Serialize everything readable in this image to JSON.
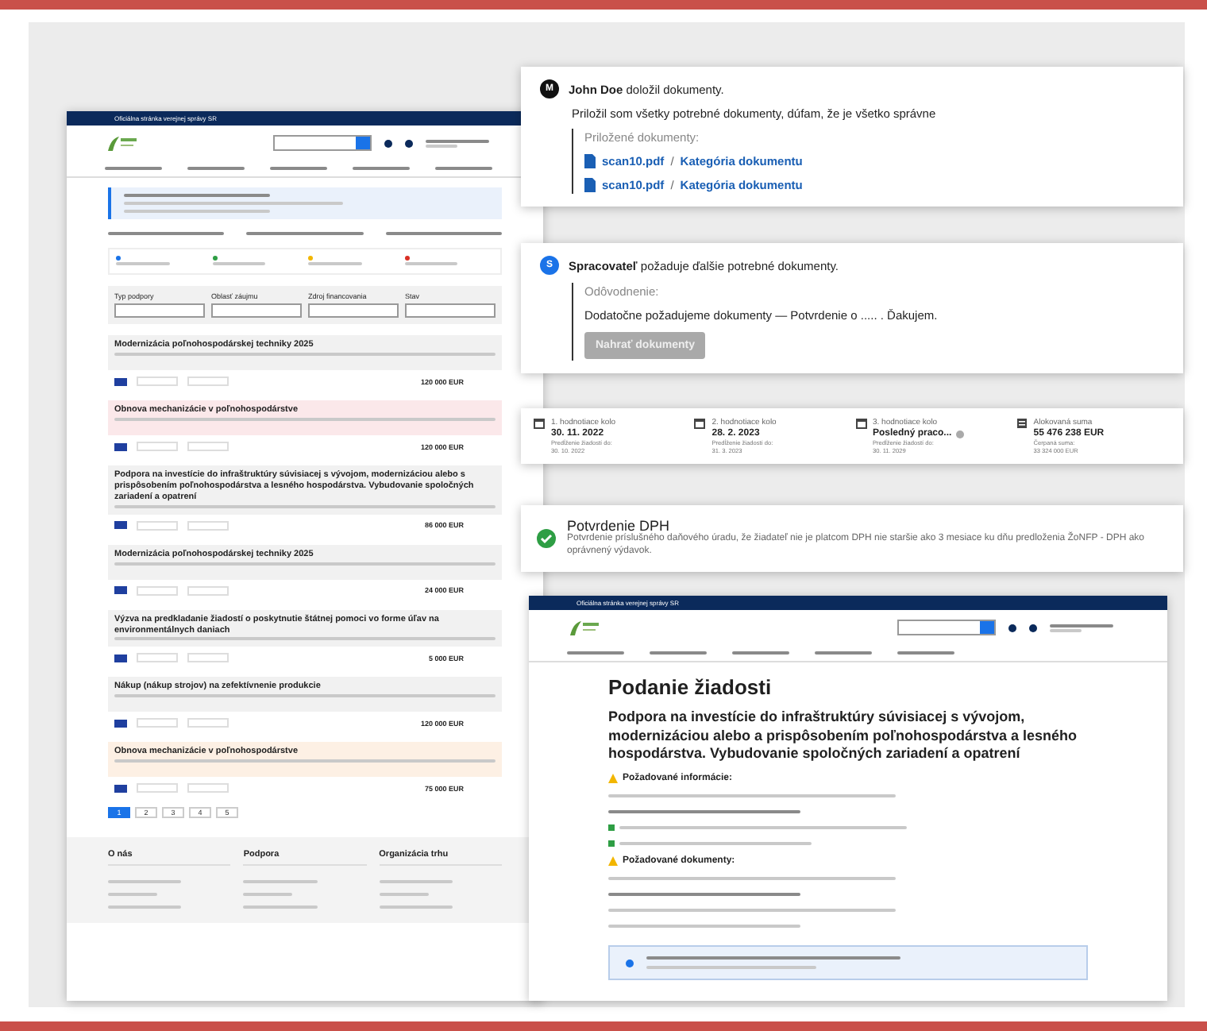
{
  "left_page": {
    "banner": "Oficiálna stránka verejnej správy SR",
    "stats": [
      {
        "color": "#1a73e8"
      },
      {
        "color": "#2e9e44"
      },
      {
        "color": "#f2b600"
      },
      {
        "color": "#d93025"
      }
    ],
    "filters": [
      {
        "label": "Typ podpory"
      },
      {
        "label": "Oblasť záujmu"
      },
      {
        "label": "Zdroj financovania"
      },
      {
        "label": "Stav"
      }
    ],
    "cards": [
      {
        "title": "Modernizácia poľnohospodárskej techniky 2025",
        "amount": "120 000 EUR",
        "color": "#f1f1f1"
      },
      {
        "title": "Obnova mechanizácie v poľnohospodárstve",
        "amount": "120 000 EUR",
        "color": "#fbe8ea"
      },
      {
        "title": "Podpora na investície do infraštruktúry súvisiacej s vývojom, modernizáciou alebo s prispôsobením poľnohospodárstva a lesného hospodárstva. Vybudovanie spoločných zariadení a opatrení",
        "amount": "86 000 EUR",
        "color": "#f1f1f1"
      },
      {
        "title": "Modernizácia poľnohospodárskej techniky 2025",
        "amount": "24 000 EUR",
        "color": "#f1f1f1"
      },
      {
        "title": "Výzva na predkladanie žiadostí o poskytnutie štátnej pomoci vo forme úľav na environmentálnych daniach",
        "amount": "5 000 EUR",
        "color": "#f1f1f1"
      },
      {
        "title": "Nákup (nákup strojov) na zefektívnenie produkcie",
        "amount": "120 000 EUR",
        "color": "#f1f1f1"
      },
      {
        "title": "Obnova mechanizácie v poľnohospodárstve",
        "amount": "75 000 EUR",
        "color": "#fdf0e4"
      }
    ],
    "pages": [
      {
        "label": "1",
        "selected": true
      },
      {
        "label": "2",
        "selected": false
      },
      {
        "label": "3",
        "selected": false
      },
      {
        "label": "4",
        "selected": false
      },
      {
        "label": "5",
        "selected": false
      }
    ],
    "footer_columns": [
      {
        "heading": "O nás"
      },
      {
        "heading": "Podpora"
      },
      {
        "heading": "Organizácia trhu"
      }
    ]
  },
  "comments": [
    {
      "avatar": "M",
      "color": "#111111",
      "author": "John Doe",
      "action": "doložil dokumenty.",
      "message": "Priložil som všetky potrebné dokumenty, dúfam, že je všetko správne",
      "quote_label": "Priložené dokumenty:",
      "attachments": [
        {
          "file": "scan10.pdf",
          "separator": "/",
          "category": "Kategória dokumentu"
        },
        {
          "file": "scan10.pdf",
          "separator": "/",
          "category": "Kategória dokumentu"
        }
      ]
    },
    {
      "avatar": "S",
      "color": "#1a73e8",
      "author": "Spracovateľ",
      "action": "požaduje ďalšie potrebné dokumenty.",
      "quote_label": "Odôvodnenie:",
      "quote_text": "Dodatočne požadujeme dokumenty — Potvrdenie o ..... . Ďakujem.",
      "button": {
        "label": "Nahrať dokumenty",
        "disabled": true
      }
    }
  ],
  "rounds": [
    {
      "kind": "round",
      "label": "1. hodnotiace kolo",
      "value": "30. 11. 2022",
      "sublabel": "Predĺženie žiadostí do:",
      "subvalue": "30. 10. 2022"
    },
    {
      "kind": "round",
      "label": "2. hodnotiace kolo",
      "value": "28. 2. 2023",
      "sublabel": "Predĺženie žiadostí do:",
      "subvalue": "31. 3. 2023"
    },
    {
      "kind": "round",
      "label": "3. hodnotiace kolo",
      "value": "Posledný praco...",
      "info": true,
      "sublabel": "Predĺženie žiadostí do:",
      "subvalue": "30. 11. 2029"
    },
    {
      "kind": "sum",
      "label": "Alokovaná suma",
      "value": "55 476 238 EUR",
      "sublabel": "Čerpaná suma:",
      "subvalue": "33 324 000 EUR"
    }
  ],
  "vat": {
    "title": "Potvrdenie DPH",
    "text": "Potvrdenie príslušného daňového úradu, že žiadateľ nie je platcom DPH nie staršie ako 3 mesiace ku dňu predloženia ŽoNFP - DPH ako oprávnený výdavok.",
    "done": true
  },
  "application": {
    "banner": "Oficiálna stránka verejnej správy SR",
    "title": "Podanie žiadosti",
    "subtitle": "Podpora na investície do infraštruktúry súvisiacej s vývojom, modernizáciou alebo a prispôsobením poľnohospodárstva a lesného hospodárstva. Vybudovanie spoločných zariadení a opatrení",
    "sections": [
      {
        "heading": "Požadované informácie:"
      },
      {
        "heading": "Požadované dokumenty:"
      }
    ]
  }
}
